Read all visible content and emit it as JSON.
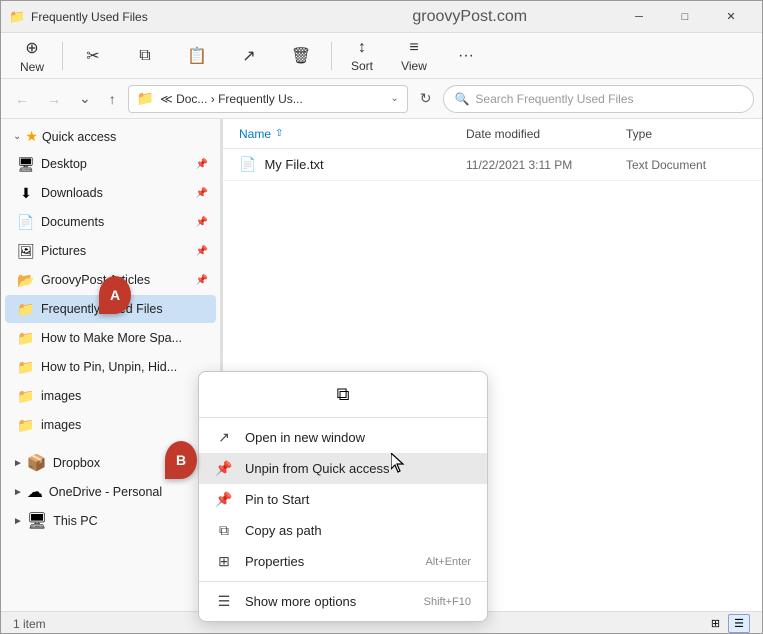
{
  "titleBar": {
    "icon": "📁",
    "title": "Frequently Used Files",
    "siteLabel": "groovyPost.com",
    "minimize": "─",
    "maximize": "□",
    "close": "✕"
  },
  "toolbar": {
    "newLabel": "New",
    "newIcon": "⊕",
    "cutIcon": "✂",
    "copyIcon": "⧉",
    "pasteIcon": "📋",
    "shareIcon": "↗",
    "deleteIcon": "🗑",
    "sortLabel": "Sort",
    "sortIcon": "↕",
    "viewLabel": "View",
    "viewIcon": "≡",
    "moreIcon": "···"
  },
  "addressBar": {
    "pathDisplay": "≪ Doc... › Frequently Us...",
    "pathIcon": "📁",
    "searchPlaceholder": "Search Frequently Used Files"
  },
  "sidebar": {
    "quickAccessLabel": "Quick access",
    "items": [
      {
        "label": "Desktop",
        "icon": "🖥",
        "pinned": true
      },
      {
        "label": "Downloads",
        "icon": "⬇",
        "pinned": true
      },
      {
        "label": "Documents",
        "icon": "📄",
        "pinned": true
      },
      {
        "label": "Pictures",
        "icon": "🖼",
        "pinned": true
      },
      {
        "label": "GroovyPost Articles",
        "icon": "📂",
        "pinned": true
      },
      {
        "label": "Frequently Used Files",
        "icon": "📁",
        "active": true
      },
      {
        "label": "How to Make More Spa...",
        "icon": "📁"
      },
      {
        "label": "How to Pin, Unpin, Hid...",
        "icon": "📁"
      },
      {
        "label": "images",
        "icon": "📁"
      },
      {
        "label": "images",
        "icon": "📁"
      }
    ],
    "dropboxLabel": "Dropbox",
    "oneDriveLabel": "OneDrive - Personal",
    "thisPCLabel": "This PC"
  },
  "fileList": {
    "colName": "Name",
    "colDate": "Date modified",
    "colType": "Type",
    "files": [
      {
        "icon": "📄",
        "name": "My File.txt",
        "date": "11/22/2021 3:11 PM",
        "type": "Text Document"
      }
    ]
  },
  "contextMenu": {
    "topIcon": "⧉",
    "items": [
      {
        "icon": "↗",
        "label": "Open in new window",
        "shortcut": ""
      },
      {
        "icon": "📌",
        "label": "Unpin from Quick access",
        "shortcut": "",
        "highlighted": true
      },
      {
        "icon": "📌",
        "label": "Pin to Start",
        "shortcut": ""
      },
      {
        "icon": "⧉",
        "label": "Copy as path",
        "shortcut": ""
      },
      {
        "icon": "⊞",
        "label": "Properties",
        "shortcut": "Alt+Enter"
      },
      {
        "icon": "☰",
        "label": "Show more options",
        "shortcut": "Shift+F10"
      }
    ]
  },
  "statusBar": {
    "itemCount": "1 item",
    "viewGrid": "⊞",
    "viewList": "☰"
  },
  "badges": {
    "A": "A",
    "B": "B"
  }
}
